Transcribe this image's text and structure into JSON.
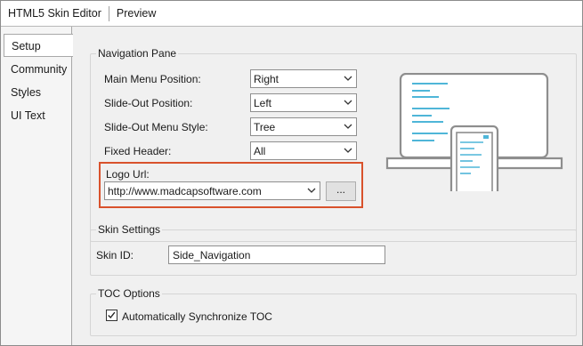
{
  "titlebar": {
    "app_title": "HTML5 Skin Editor",
    "preview_tab": "Preview"
  },
  "sidebar": {
    "items": [
      {
        "label": "Setup"
      },
      {
        "label": "Community"
      },
      {
        "label": "Styles"
      },
      {
        "label": "UI Text"
      }
    ]
  },
  "navigation_pane": {
    "legend": "Navigation Pane",
    "main_menu_position": {
      "label": "Main Menu Position:",
      "value": "Right"
    },
    "slide_out_position": {
      "label": "Slide-Out Position:",
      "value": "Left"
    },
    "slide_out_menu_style": {
      "label": "Slide-Out Menu Style:",
      "value": "Tree"
    },
    "fixed_header": {
      "label": "Fixed Header:",
      "value": "All"
    },
    "logo_url": {
      "label": "Logo Url:",
      "value": "http://www.madcapsoftware.com",
      "browse_label": "..."
    },
    "highlight_color": "#d9522c",
    "illustration_color": "#4fb6d8"
  },
  "skin_settings": {
    "legend": "Skin Settings",
    "skin_id_label": "Skin ID:",
    "skin_id_value": "Side_Navigation"
  },
  "toc_options": {
    "legend": "TOC Options",
    "auto_sync_label": "Automatically Synchronize TOC",
    "auto_sync_checked": true
  }
}
